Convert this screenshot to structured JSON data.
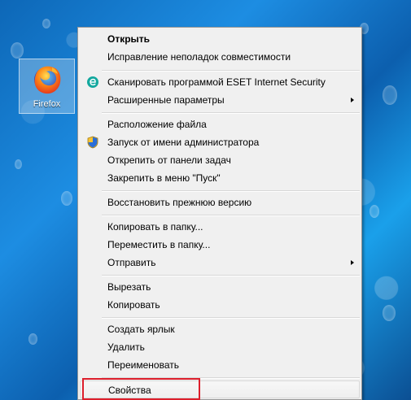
{
  "desktop": {
    "icon": {
      "label": "Firefox",
      "icon": "firefox-icon"
    }
  },
  "context_menu": {
    "items": [
      {
        "label": "Открыть",
        "bold": true
      },
      {
        "label": "Исправление неполадок совместимости"
      },
      {
        "label": "Сканировать программой ESET Internet Security",
        "icon": "eset-icon"
      },
      {
        "label": "Расширенные параметры",
        "submenu": true
      },
      {
        "label": "Расположение файла"
      },
      {
        "label": "Запуск от имени администратора",
        "icon": "uac-shield-icon"
      },
      {
        "label": "Открепить от панели задач"
      },
      {
        "label": "Закрепить в меню \"Пуск\""
      },
      {
        "label": "Восстановить прежнюю версию"
      },
      {
        "label": "Копировать в папку..."
      },
      {
        "label": "Переместить в папку..."
      },
      {
        "label": "Отправить",
        "submenu": true
      },
      {
        "label": "Вырезать"
      },
      {
        "label": "Копировать"
      },
      {
        "label": "Создать ярлык"
      },
      {
        "label": "Удалить"
      },
      {
        "label": "Переименовать"
      },
      {
        "label": "Свойства",
        "highlighted": true
      }
    ]
  },
  "colors": {
    "annotation_red": "#dd1f2c",
    "menu_background": "#f0f0f0",
    "desktop_blue": "#1d8de2"
  }
}
